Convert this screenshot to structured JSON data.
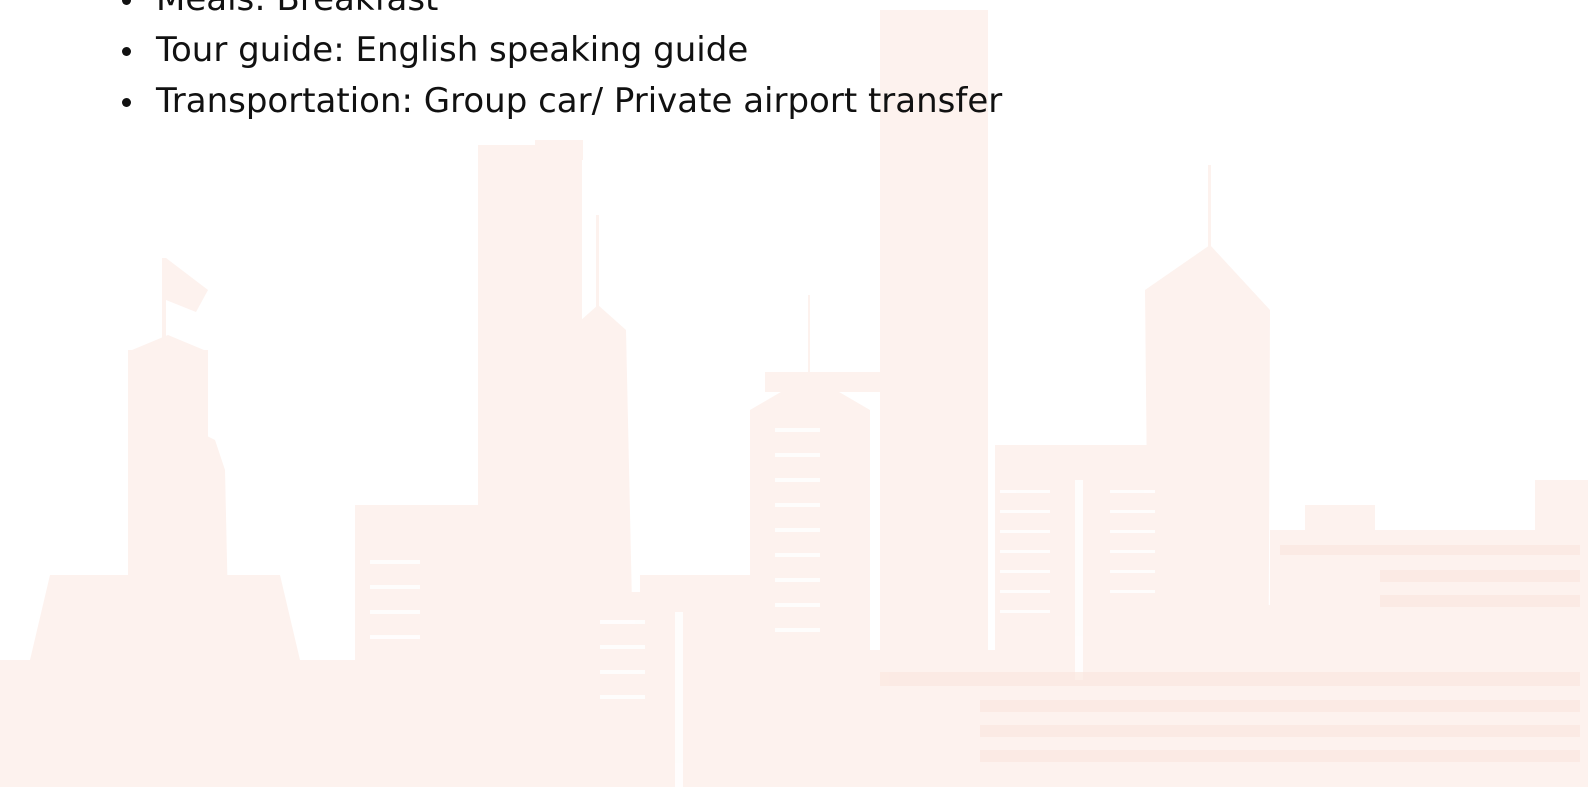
{
  "details": {
    "items": [
      {
        "label": "Meals: Breakfast"
      },
      {
        "label": "Tour guide: English speaking guide"
      },
      {
        "label": "Transportation: Group car/ Private airport transfer"
      }
    ]
  },
  "colors": {
    "text": "#111111",
    "skyline_light": "#fdf1ec",
    "skyline_mid": "#fbe5dc"
  }
}
